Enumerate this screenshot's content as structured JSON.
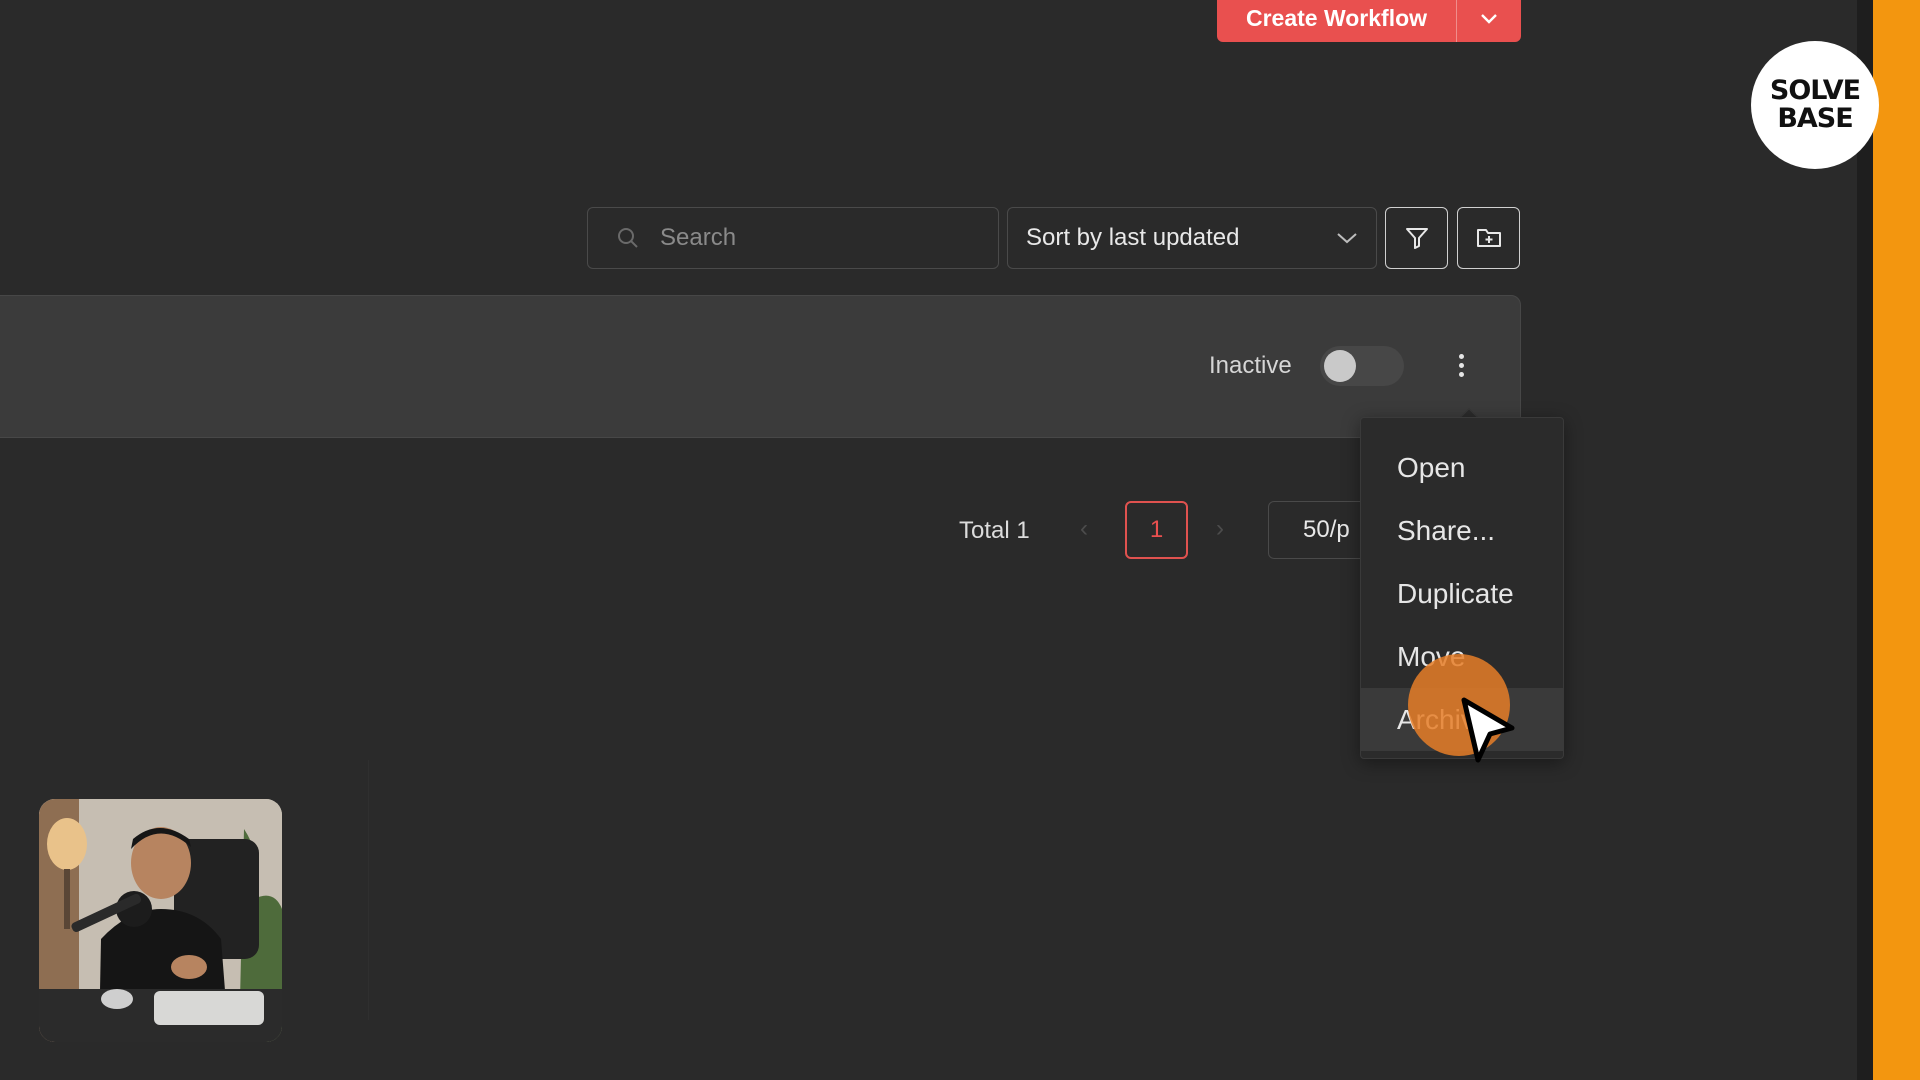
{
  "header": {
    "create_label": "Create Workflow"
  },
  "toolbar": {
    "search_placeholder": "Search",
    "sort_label": "Sort by last updated"
  },
  "workflow_row": {
    "status_label": "Inactive",
    "active": false
  },
  "pagination": {
    "total_label": "Total 1",
    "current_page": "1",
    "per_page": "50/p"
  },
  "menu": {
    "items": [
      {
        "label": "Open"
      },
      {
        "label": "Share..."
      },
      {
        "label": "Duplicate"
      },
      {
        "label": "Move"
      },
      {
        "label": "Archive"
      }
    ]
  },
  "branding": {
    "logo_line1": "SOLVE",
    "logo_line2": "BASE",
    "accent": "#e9504f",
    "strip": "#f3960f"
  }
}
